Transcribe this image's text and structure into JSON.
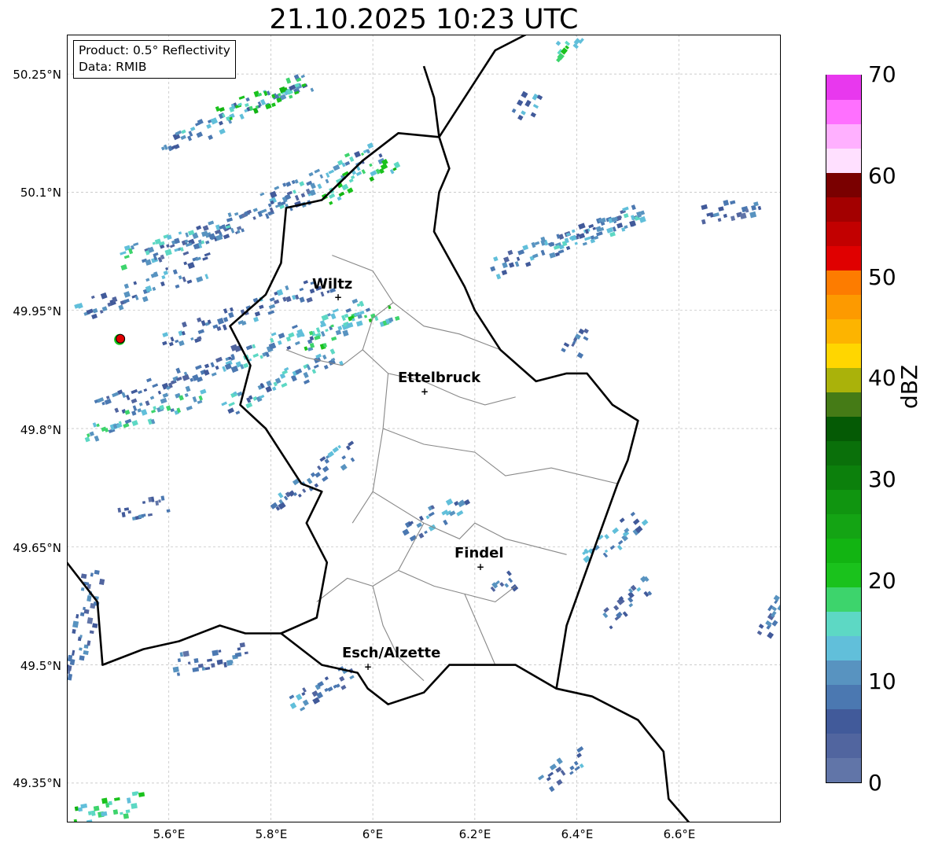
{
  "title": "21.10.2025 10:23 UTC",
  "info_box": {
    "product": "Product: 0.5° Reflectivity",
    "data": "Data: RMIB"
  },
  "colorbar": {
    "label": "dBZ",
    "ticks": [
      "0",
      "10",
      "20",
      "30",
      "40",
      "50",
      "60",
      "70"
    ],
    "range": [
      0,
      70
    ],
    "colors": [
      "#6175a8",
      "#51659f",
      "#415a9a",
      "#4b78b1",
      "#5893c0",
      "#61bfda",
      "#5dd8c4",
      "#3dd46c",
      "#1ac21c",
      "#12b412",
      "#14a414",
      "#109510",
      "#0c800c",
      "#0a700a",
      "#055a05",
      "#457b16",
      "#aab20a",
      "#ffd600",
      "#fdb400",
      "#fd9a00",
      "#fd7c00",
      "#e00000",
      "#c20000",
      "#a30000",
      "#7a0000",
      "#ffe0ff",
      "#ffb0ff",
      "#ff70ff",
      "#e838ee"
    ]
  },
  "axes": {
    "lat_labels": [
      "50.25°N",
      "50.1°N",
      "49.95°N",
      "49.8°N",
      "49.65°N",
      "49.5°N",
      "49.35°N"
    ],
    "lon_labels": [
      "5.6°E",
      "5.8°E",
      "6°E",
      "6.2°E",
      "6.4°E",
      "6.6°E"
    ]
  },
  "cities": [
    {
      "name": "Wiltz",
      "lon": 5.93,
      "lat": 49.966
    },
    {
      "name": "Ettelbruck",
      "lon": 6.1,
      "lat": 49.847
    },
    {
      "name": "Findel",
      "lon": 6.21,
      "lat": 49.627
    },
    {
      "name": "Esch/Alzette",
      "lon": 5.99,
      "lat": 49.497
    }
  ],
  "radar_site": {
    "lon": 5.505,
    "lat": 49.914
  },
  "extent": {
    "lon_min": 5.4,
    "lon_max": 6.8,
    "lat_min": 49.3,
    "lat_max": 50.3
  },
  "echo_bands": [
    {
      "lon": 5.73,
      "lat": 50.2,
      "angle": 25,
      "len": 0.32,
      "dbz": 12
    },
    {
      "lon": 5.78,
      "lat": 50.22,
      "angle": 20,
      "len": 0.18,
      "dbz": 22
    },
    {
      "lon": 5.9,
      "lat": 50.12,
      "angle": 25,
      "len": 0.25,
      "dbz": 14
    },
    {
      "lon": 5.97,
      "lat": 50.12,
      "angle": 28,
      "len": 0.16,
      "dbz": 20
    },
    {
      "lon": 5.72,
      "lat": 50.06,
      "angle": 22,
      "len": 0.35,
      "dbz": 8
    },
    {
      "lon": 5.62,
      "lat": 50.04,
      "angle": 18,
      "len": 0.25,
      "dbz": 15
    },
    {
      "lon": 5.55,
      "lat": 49.98,
      "angle": 20,
      "len": 0.28,
      "dbz": 10
    },
    {
      "lon": 5.75,
      "lat": 49.95,
      "angle": 20,
      "len": 0.35,
      "dbz": 10
    },
    {
      "lon": 5.85,
      "lat": 49.92,
      "angle": 22,
      "len": 0.3,
      "dbz": 14
    },
    {
      "lon": 5.95,
      "lat": 49.93,
      "angle": 18,
      "len": 0.2,
      "dbz": 18
    },
    {
      "lon": 5.6,
      "lat": 49.86,
      "angle": 22,
      "len": 0.3,
      "dbz": 9
    },
    {
      "lon": 5.82,
      "lat": 49.86,
      "angle": 25,
      "len": 0.25,
      "dbz": 12
    },
    {
      "lon": 5.55,
      "lat": 49.82,
      "angle": 20,
      "len": 0.25,
      "dbz": 16
    },
    {
      "lon": 6.38,
      "lat": 50.04,
      "angle": 20,
      "len": 0.32,
      "dbz": 10
    },
    {
      "lon": 6.43,
      "lat": 50.05,
      "angle": 18,
      "len": 0.2,
      "dbz": 13
    },
    {
      "lon": 6.7,
      "lat": 50.08,
      "angle": 15,
      "len": 0.12,
      "dbz": 6
    },
    {
      "lon": 6.4,
      "lat": 49.91,
      "angle": 60,
      "len": 0.06,
      "dbz": 8
    },
    {
      "lon": 5.88,
      "lat": 49.74,
      "angle": 35,
      "len": 0.2,
      "dbz": 10
    },
    {
      "lon": 6.12,
      "lat": 49.69,
      "angle": 30,
      "len": 0.14,
      "dbz": 11
    },
    {
      "lon": 6.47,
      "lat": 49.66,
      "angle": 40,
      "len": 0.14,
      "dbz": 12
    },
    {
      "lon": 6.5,
      "lat": 49.58,
      "angle": 40,
      "len": 0.12,
      "dbz": 9
    },
    {
      "lon": 5.43,
      "lat": 49.55,
      "angle": 80,
      "len": 0.22,
      "dbz": 7
    },
    {
      "lon": 5.9,
      "lat": 49.47,
      "angle": 30,
      "len": 0.14,
      "dbz": 9
    },
    {
      "lon": 5.68,
      "lat": 49.51,
      "angle": 10,
      "len": 0.15,
      "dbz": 8
    },
    {
      "lon": 6.37,
      "lat": 49.37,
      "angle": 35,
      "len": 0.1,
      "dbz": 10
    },
    {
      "lon": 5.48,
      "lat": 49.32,
      "angle": 10,
      "len": 0.14,
      "dbz": 20
    },
    {
      "lon": 6.78,
      "lat": 49.56,
      "angle": 55,
      "len": 0.08,
      "dbz": 9
    },
    {
      "lon": 5.55,
      "lat": 49.7,
      "angle": 10,
      "len": 0.1,
      "dbz": 8
    },
    {
      "lon": 6.26,
      "lat": 49.6,
      "angle": 40,
      "len": 0.05,
      "dbz": 7
    },
    {
      "lon": 6.3,
      "lat": 50.21,
      "angle": 60,
      "len": 0.06,
      "dbz": 10
    },
    {
      "lon": 6.38,
      "lat": 50.29,
      "angle": 50,
      "len": 0.08,
      "dbz": 20
    }
  ],
  "lux_border": [
    [
      6.13,
      50.17
    ],
    [
      6.05,
      50.175
    ],
    [
      5.98,
      50.14
    ],
    [
      5.9,
      50.09
    ],
    [
      5.83,
      50.08
    ],
    [
      5.82,
      50.01
    ],
    [
      5.79,
      49.97
    ],
    [
      5.72,
      49.93
    ],
    [
      5.76,
      49.88
    ],
    [
      5.74,
      49.83
    ],
    [
      5.79,
      49.8
    ],
    [
      5.86,
      49.73
    ],
    [
      5.9,
      49.72
    ],
    [
      5.87,
      49.68
    ],
    [
      5.91,
      49.63
    ],
    [
      5.89,
      49.56
    ],
    [
      5.82,
      49.54
    ],
    [
      5.9,
      49.5
    ],
    [
      5.97,
      49.49
    ],
    [
      5.99,
      49.47
    ],
    [
      6.03,
      49.45
    ],
    [
      6.1,
      49.465
    ],
    [
      6.15,
      49.5
    ],
    [
      6.2,
      49.5
    ],
    [
      6.28,
      49.5
    ],
    [
      6.36,
      49.47
    ],
    [
      6.38,
      49.55
    ],
    [
      6.43,
      49.64
    ],
    [
      6.48,
      49.73
    ],
    [
      6.5,
      49.76
    ],
    [
      6.52,
      49.81
    ],
    [
      6.47,
      49.83
    ],
    [
      6.42,
      49.87
    ],
    [
      6.38,
      49.87
    ],
    [
      6.32,
      49.86
    ],
    [
      6.25,
      49.9
    ],
    [
      6.2,
      49.95
    ],
    [
      6.18,
      49.98
    ],
    [
      6.12,
      50.05
    ],
    [
      6.13,
      50.1
    ],
    [
      6.15,
      50.13
    ],
    [
      6.13,
      50.17
    ]
  ],
  "other_borders": [
    [
      [
        5.4,
        49.63
      ],
      [
        5.46,
        49.58
      ],
      [
        5.47,
        49.5
      ],
      [
        5.55,
        49.52
      ],
      [
        5.62,
        49.53
      ],
      [
        5.7,
        49.55
      ],
      [
        5.75,
        49.54
      ],
      [
        5.82,
        49.54
      ]
    ],
    [
      [
        6.36,
        49.47
      ],
      [
        6.43,
        49.46
      ],
      [
        6.52,
        49.43
      ],
      [
        6.57,
        49.39
      ],
      [
        6.58,
        49.33
      ],
      [
        6.62,
        49.3
      ]
    ],
    [
      [
        6.13,
        50.17
      ],
      [
        6.16,
        50.2
      ],
      [
        6.2,
        50.24
      ],
      [
        6.24,
        50.28
      ],
      [
        6.3,
        50.3
      ]
    ],
    [
      [
        6.13,
        50.17
      ],
      [
        6.12,
        50.22
      ],
      [
        6.1,
        50.26
      ]
    ]
  ],
  "districts": [
    [
      [
        5.92,
        50.02
      ],
      [
        6.0,
        50.0
      ],
      [
        6.04,
        49.96
      ],
      [
        6.0,
        49.94
      ],
      [
        5.98,
        49.9
      ],
      [
        5.94,
        49.88
      ],
      [
        5.87,
        49.89
      ],
      [
        5.83,
        49.9
      ]
    ],
    [
      [
        6.04,
        49.96
      ],
      [
        6.1,
        49.93
      ],
      [
        6.17,
        49.92
      ],
      [
        6.25,
        49.9
      ]
    ],
    [
      [
        5.98,
        49.9
      ],
      [
        6.03,
        49.87
      ],
      [
        6.1,
        49.86
      ],
      [
        6.17,
        49.84
      ],
      [
        6.22,
        49.83
      ],
      [
        6.28,
        49.84
      ]
    ],
    [
      [
        6.03,
        49.87
      ],
      [
        6.02,
        49.8
      ],
      [
        6.0,
        49.72
      ],
      [
        5.96,
        49.68
      ]
    ],
    [
      [
        6.02,
        49.8
      ],
      [
        6.1,
        49.78
      ],
      [
        6.2,
        49.77
      ],
      [
        6.26,
        49.74
      ],
      [
        6.35,
        49.75
      ],
      [
        6.48,
        49.73
      ]
    ],
    [
      [
        6.0,
        49.72
      ],
      [
        6.1,
        49.68
      ],
      [
        6.17,
        49.66
      ],
      [
        6.2,
        49.68
      ],
      [
        6.26,
        49.66
      ],
      [
        6.38,
        49.64
      ]
    ],
    [
      [
        6.1,
        49.68
      ],
      [
        6.05,
        49.62
      ],
      [
        6.0,
        49.6
      ],
      [
        5.95,
        49.61
      ],
      [
        5.89,
        49.58
      ]
    ],
    [
      [
        6.05,
        49.62
      ],
      [
        6.12,
        49.6
      ],
      [
        6.18,
        49.59
      ],
      [
        6.24,
        49.58
      ],
      [
        6.28,
        49.6
      ]
    ],
    [
      [
        6.18,
        49.59
      ],
      [
        6.22,
        49.53
      ],
      [
        6.24,
        49.5
      ]
    ],
    [
      [
        6.0,
        49.6
      ],
      [
        6.02,
        49.55
      ],
      [
        6.05,
        49.51
      ],
      [
        6.1,
        49.48
      ]
    ]
  ]
}
